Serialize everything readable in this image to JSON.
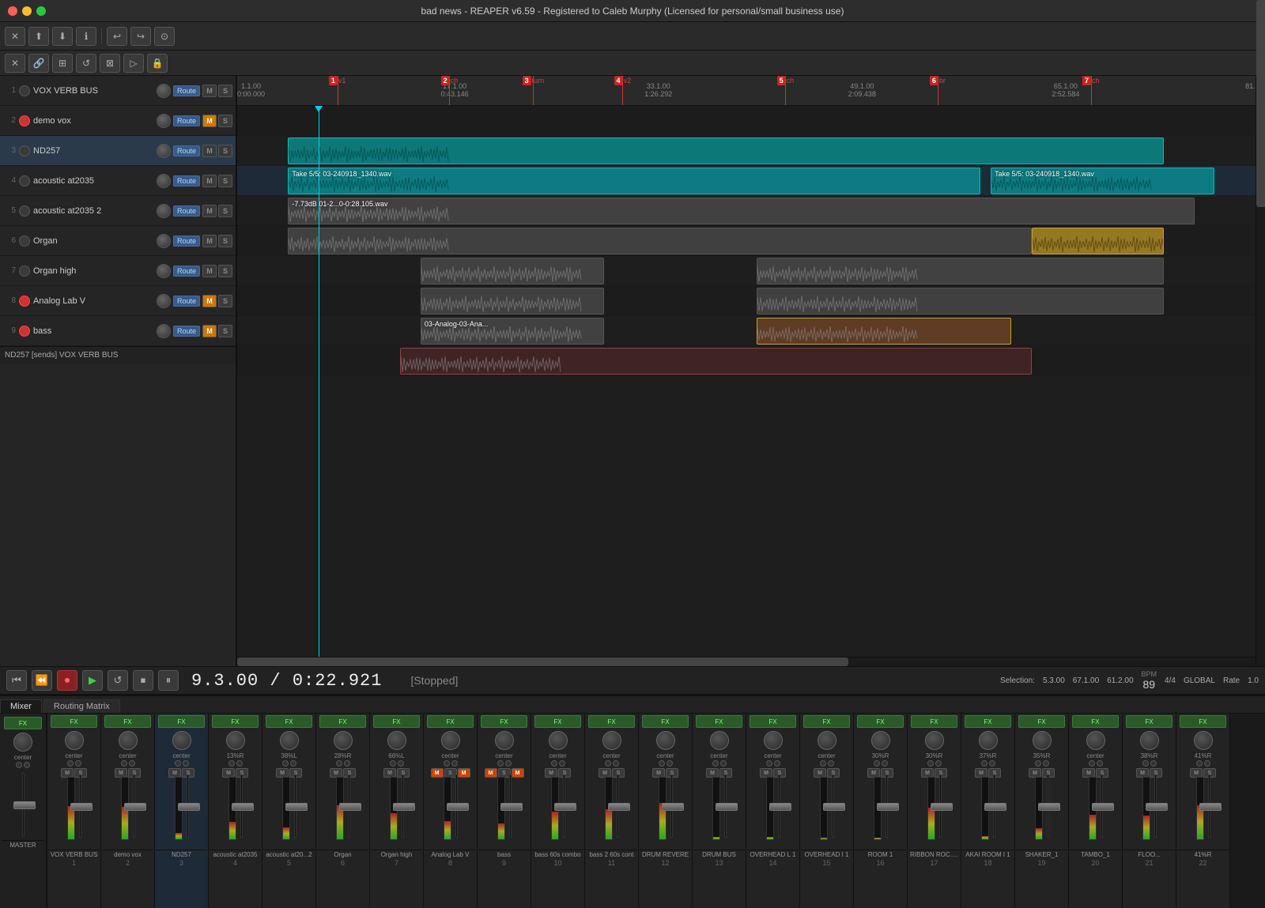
{
  "app": {
    "title": "bad news - REAPER v6.59 - Registered to Caleb Murphy (Licensed for personal/small business use)"
  },
  "toolbar": {
    "buttons": [
      "✕",
      "⬆",
      "⬇",
      "ℹ",
      "↩",
      "↪",
      "⊙"
    ]
  },
  "toolbar2": {
    "buttons": [
      "✕",
      "🔗",
      "⊞",
      "↺",
      "⊠",
      "▷",
      "🔒"
    ]
  },
  "tracks": [
    {
      "num": 1,
      "name": "VOX VERB BUS",
      "armed": false,
      "muted": false,
      "soloed": false,
      "has_m": true,
      "has_s": true
    },
    {
      "num": 2,
      "name": "demo vox",
      "armed": true,
      "muted": true,
      "soloed": false,
      "has_m": true,
      "has_s": true
    },
    {
      "num": 3,
      "name": "ND257",
      "armed": false,
      "muted": false,
      "soloed": false,
      "has_m": true,
      "has_s": true
    },
    {
      "num": 4,
      "name": "acoustic at2035",
      "armed": false,
      "muted": false,
      "soloed": false,
      "has_m": true,
      "has_s": true
    },
    {
      "num": 5,
      "name": "acoustic at2035 2",
      "armed": false,
      "muted": false,
      "soloed": false,
      "has_m": true,
      "has_s": true
    },
    {
      "num": 6,
      "name": "Organ",
      "armed": false,
      "muted": false,
      "soloed": false,
      "has_m": true,
      "has_s": true
    },
    {
      "num": 7,
      "name": "Organ high",
      "armed": false,
      "muted": false,
      "soloed": false,
      "has_m": true,
      "has_s": true
    },
    {
      "num": 8,
      "name": "Analog Lab V",
      "armed": true,
      "muted": true,
      "soloed": false,
      "has_m": true,
      "has_s": true
    },
    {
      "num": 9,
      "name": "bass",
      "armed": true,
      "muted": true,
      "soloed": false,
      "has_m": true,
      "has_s": true
    }
  ],
  "markers": [
    {
      "num": 1,
      "label": "v1",
      "pos_pct": 9
    },
    {
      "num": 2,
      "label": "ch",
      "pos_pct": 20
    },
    {
      "num": 3,
      "label": "turn",
      "pos_pct": 28
    },
    {
      "num": 4,
      "label": "v2",
      "pos_pct": 37
    },
    {
      "num": 5,
      "label": "ch",
      "pos_pct": 53
    },
    {
      "num": 6,
      "label": "br",
      "pos_pct": 68
    },
    {
      "num": 7,
      "label": "ch",
      "pos_pct": 83
    }
  ],
  "ruler": {
    "marks": [
      {
        "label": "1.1.00\n0:00.000",
        "pos_pct": 0
      },
      {
        "label": "17.1.00\n0:43.146",
        "pos_pct": 20
      },
      {
        "label": "33.1.00\n1:26.292",
        "pos_pct": 40
      },
      {
        "label": "49.1.00\n2:09.438",
        "pos_pct": 60
      },
      {
        "label": "65.1.00\n2:52.584",
        "pos_pct": 80
      },
      {
        "label": "81.",
        "pos_pct": 99
      }
    ]
  },
  "transport": {
    "time": "9.3.00 / 0:22.921",
    "status": "[Stopped]",
    "selection_label": "Selection:",
    "sel_start": "5.3.00",
    "sel_end": "67.1.00",
    "sel_len": "61.2.00",
    "bpm_label": "BPM",
    "bpm": "89",
    "time_sig": "4/4",
    "global_label": "GLOBAL",
    "rate_label": "Rate",
    "rate": "1.0"
  },
  "mixer": {
    "tabs": [
      "Mixer",
      "Routing Matrix"
    ],
    "active_tab": "Mixer",
    "master_label": "MASTER",
    "channels": [
      {
        "name": "VOX VERB BUS",
        "num": 1,
        "pan": "center",
        "muted": false,
        "armed": false
      },
      {
        "name": "demo vox",
        "num": 2,
        "pan": "center",
        "muted": false,
        "armed": false
      },
      {
        "name": "ND257",
        "num": 3,
        "pan": "center",
        "muted": false,
        "armed": false,
        "selected": true
      },
      {
        "name": "acoustic at2035",
        "num": 4,
        "pan": "13%R",
        "muted": false,
        "armed": false
      },
      {
        "name": "acoustic at20...2",
        "num": 5,
        "pan": "38%L",
        "muted": false,
        "armed": false
      },
      {
        "name": "Organ",
        "num": 6,
        "pan": "28%R",
        "muted": false,
        "armed": false
      },
      {
        "name": "Organ high",
        "num": 7,
        "pan": "66%L",
        "muted": false,
        "armed": false
      },
      {
        "name": "Analog Lab V",
        "num": 8,
        "pan": "center",
        "muted": true,
        "armed": true
      },
      {
        "name": "bass",
        "num": 9,
        "pan": "center",
        "muted": true,
        "armed": true
      },
      {
        "name": "bass 60s combo",
        "num": 10,
        "pan": "center",
        "muted": false,
        "armed": false
      },
      {
        "name": "bass 2 60s cont",
        "num": 11,
        "pan": "center",
        "muted": false,
        "armed": false
      },
      {
        "name": "DRUM REVERE",
        "num": 12,
        "pan": "center",
        "muted": false,
        "armed": false
      },
      {
        "name": "DRUM BUS",
        "num": 13,
        "pan": "center",
        "muted": false,
        "armed": false
      },
      {
        "name": "OVERHEAD L 1",
        "num": 14,
        "pan": "center",
        "muted": false,
        "armed": false
      },
      {
        "name": "OVERHEAD I 1",
        "num": 15,
        "pan": "center",
        "muted": false,
        "armed": false
      },
      {
        "name": "ROOM 1",
        "num": 16,
        "pan": "30%R",
        "muted": false,
        "armed": false
      },
      {
        "name": "RIBBON ROC...1",
        "num": 17,
        "pan": "30%R",
        "muted": false,
        "armed": false
      },
      {
        "name": "AKAI ROOM I 1",
        "num": 18,
        "pan": "37%R",
        "muted": false,
        "armed": false
      },
      {
        "name": "SHAKER_1",
        "num": 19,
        "pan": "35%R",
        "muted": false,
        "armed": false
      },
      {
        "name": "TAMBO_1",
        "num": 20,
        "pan": "center",
        "muted": false,
        "armed": false
      },
      {
        "name": "FLOO...",
        "num": 21,
        "pan": "38%R",
        "muted": false,
        "armed": false
      },
      {
        "name": "41%R",
        "num": 22,
        "pan": "41%R",
        "muted": false,
        "armed": false
      }
    ]
  },
  "footer_status": "ND257 [sends] VOX VERB BUS",
  "clips": {
    "track1": [],
    "track2": [
      {
        "left_pct": 5,
        "width_pct": 86,
        "color": "cyan",
        "label": ""
      }
    ],
    "track3": [
      {
        "left_pct": 5,
        "width_pct": 68,
        "color": "cyan",
        "label": "Take 5/5: 03-240918_1340.wav"
      },
      {
        "left_pct": 74,
        "width_pct": 22,
        "color": "cyan",
        "label": "Take 5/5: 03-240918_1340.wav"
      }
    ],
    "track4": [
      {
        "left_pct": 5,
        "width_pct": 89,
        "color": "dark",
        "label": "-7.73dB 01-2...0-0:28.105.wav"
      }
    ],
    "track5": [
      {
        "left_pct": 5,
        "width_pct": 73,
        "color": "dark",
        "label": ""
      },
      {
        "left_pct": 78,
        "width_pct": 13,
        "color": "gold",
        "label": ""
      }
    ],
    "track6": [
      {
        "left_pct": 18,
        "width_pct": 18,
        "color": "dark",
        "label": ""
      },
      {
        "left_pct": 51,
        "width_pct": 40,
        "color": "dark",
        "label": ""
      }
    ],
    "track7": [
      {
        "left_pct": 18,
        "width_pct": 18,
        "color": "dark",
        "label": ""
      },
      {
        "left_pct": 51,
        "width_pct": 40,
        "color": "dark",
        "label": ""
      }
    ],
    "track8": [
      {
        "left_pct": 18,
        "width_pct": 18,
        "color": "dark",
        "label": "03-Analog-03-Ana..."
      },
      {
        "left_pct": 51,
        "width_pct": 25,
        "color": "orange",
        "label": ""
      }
    ],
    "track9": [
      {
        "left_pct": 16,
        "width_pct": 62,
        "color": "red_dim",
        "label": ""
      }
    ]
  }
}
